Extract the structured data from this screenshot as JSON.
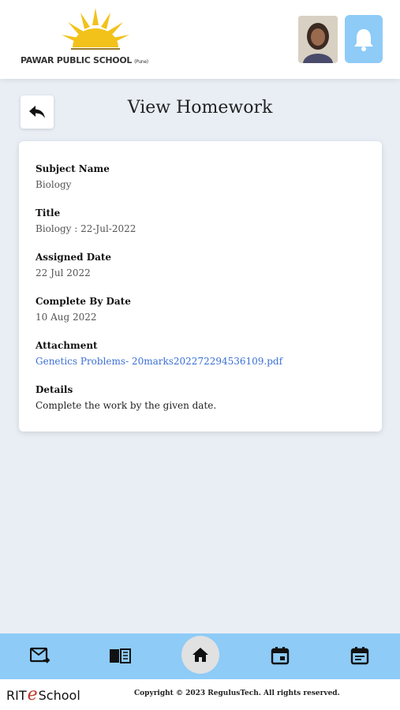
{
  "header": {
    "school_name": "PAWAR PUBLIC SCHOOL",
    "school_name_suffix": "(Pune)",
    "avatar": "student-photo",
    "bell_icon": "bell-icon"
  },
  "page": {
    "title": "View Homework",
    "back_icon": "reply-arrow-icon"
  },
  "homework": {
    "subject_label": "Subject Name",
    "subject_value": "Biology",
    "title_label": "Title",
    "title_value": "Biology : 22-Jul-2022",
    "assigned_label": "Assigned Date",
    "assigned_value": "22 Jul 2022",
    "complete_label": "Complete By Date",
    "complete_value": "10 Aug 2022",
    "attachment_label": "Attachment",
    "attachment_value": "Genetics Problems- 20marks2022722945361​09.pdf",
    "details_label": "Details",
    "details_value": "Complete the work by the given date."
  },
  "bottom_nav": {
    "items": [
      "mail-forward-icon",
      "book-icon",
      "home-icon",
      "calendar-icon",
      "schedule-icon"
    ]
  },
  "footer": {
    "brand_prefix": "RIT",
    "brand_e": "e",
    "brand_suffix": "School",
    "copyright": "Copyright © 2023 RegulusTech. All rights reserved."
  },
  "colors": {
    "accent": "#8ecbf7",
    "background": "#e9eef5",
    "link": "#3b6fd6"
  }
}
